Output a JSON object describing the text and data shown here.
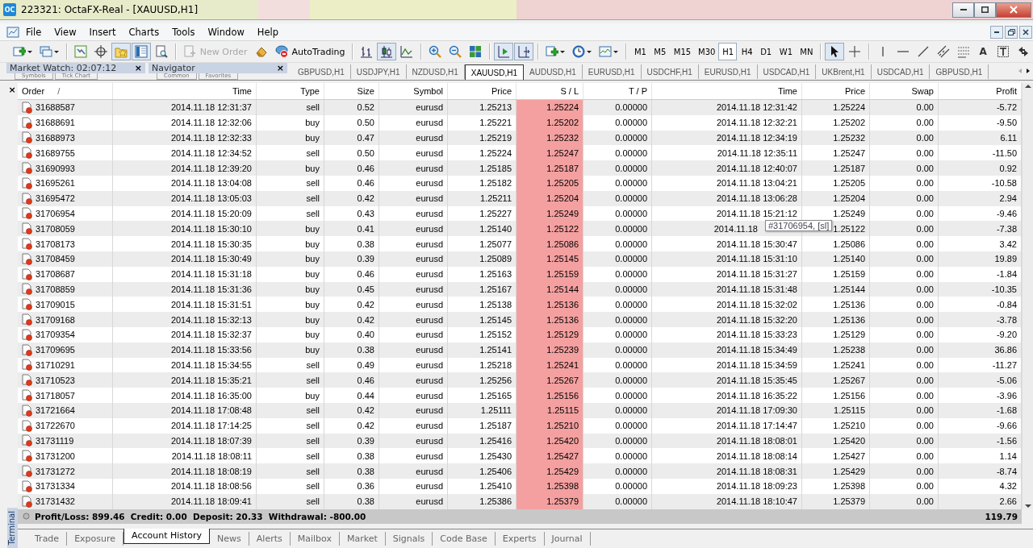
{
  "window": {
    "logo": "OC",
    "title": "223321: OctaFX-Real - [XAUUSD,H1]"
  },
  "menu": [
    "File",
    "View",
    "Insert",
    "Charts",
    "Tools",
    "Window",
    "Help"
  ],
  "toolbar": [
    {
      "kind": "icon",
      "on": false,
      "dropdown": true
    },
    {
      "kind": "icon",
      "on": false,
      "dropdown": true
    },
    {
      "kind": "separator"
    },
    {
      "kind": "icon",
      "on": false
    },
    {
      "kind": "icon",
      "on": false
    },
    {
      "kind": "icon",
      "on": true
    },
    {
      "kind": "icon",
      "on": true
    },
    {
      "kind": "icon",
      "on": false
    },
    {
      "kind": "separator"
    },
    {
      "kind": "button",
      "label": "New Order",
      "disabled": true
    },
    {
      "kind": "icon",
      "on": false
    },
    {
      "kind": "button",
      "label": "AutoTrading",
      "disabled": false
    },
    {
      "kind": "separator"
    },
    {
      "kind": "icon",
      "on": false
    },
    {
      "kind": "icon",
      "on": true
    },
    {
      "kind": "icon",
      "on": false
    },
    {
      "kind": "separator"
    },
    {
      "kind": "icon",
      "on": false
    },
    {
      "kind": "icon",
      "on": false
    },
    {
      "kind": "icon",
      "on": false
    },
    {
      "kind": "separator"
    },
    {
      "kind": "icon",
      "on": true
    },
    {
      "kind": "icon",
      "on": true
    },
    {
      "kind": "separator"
    },
    {
      "kind": "icon",
      "on": false,
      "dropdown": true
    },
    {
      "kind": "icon",
      "on": false,
      "dropdown": true
    },
    {
      "kind": "icon",
      "on": false,
      "dropdown": true
    },
    {
      "kind": "separator"
    },
    {
      "kind": "timeframe",
      "label": "M1",
      "selected": false
    },
    {
      "kind": "timeframe",
      "label": "M5",
      "selected": false
    },
    {
      "kind": "timeframe",
      "label": "M15",
      "selected": false
    },
    {
      "kind": "timeframe",
      "label": "M30",
      "selected": false
    },
    {
      "kind": "timeframe",
      "label": "H1",
      "selected": true
    },
    {
      "kind": "timeframe",
      "label": "H4",
      "selected": false
    },
    {
      "kind": "timeframe",
      "label": "D1",
      "selected": false
    },
    {
      "kind": "timeframe",
      "label": "W1",
      "selected": false
    },
    {
      "kind": "timeframe",
      "label": "MN",
      "selected": false
    },
    {
      "kind": "separator"
    },
    {
      "kind": "icon",
      "on": true
    },
    {
      "kind": "icon",
      "on": false
    },
    {
      "kind": "separator"
    },
    {
      "kind": "icon",
      "on": false
    },
    {
      "kind": "icon",
      "on": false
    },
    {
      "kind": "icon",
      "on": false
    },
    {
      "kind": "icon",
      "on": false
    },
    {
      "kind": "icon",
      "on": false
    },
    {
      "kind": "glyph",
      "label": "A"
    },
    {
      "kind": "icon",
      "on": false
    },
    {
      "kind": "icon",
      "on": false
    }
  ],
  "panels": [
    {
      "title": "Market Watch: 02:07:12",
      "close": "×",
      "tabs": [
        "Symbols",
        "Tick Chart"
      ]
    },
    {
      "title": "Navigator",
      "close": "×",
      "tabs": [
        "Common",
        "Favorites"
      ]
    }
  ],
  "chart_tabs": [
    {
      "label": "GBPUSD,H1",
      "selected": false
    },
    {
      "label": "USDJPY,H1",
      "selected": false
    },
    {
      "label": "NZDUSD,H1",
      "selected": false
    },
    {
      "label": "XAUUSD,H1",
      "selected": true
    },
    {
      "label": "AUDUSD,H1",
      "selected": false
    },
    {
      "label": "EURUSD,H1",
      "selected": false
    },
    {
      "label": "USDCHF,H1",
      "selected": false
    },
    {
      "label": "EURUSD,H1",
      "selected": false
    },
    {
      "label": "USDCAD,H1",
      "selected": false
    },
    {
      "label": "UKBrent,H1",
      "selected": false
    },
    {
      "label": "USDCAD,H1",
      "selected": false
    },
    {
      "label": "GBPUSD,H1",
      "selected": false
    }
  ],
  "terminal": {
    "label": "Terminal",
    "close": "×",
    "columns": [
      {
        "label": "Order",
        "sort": "/",
        "highlighted": false
      },
      {
        "label": "Time",
        "highlighted": false
      },
      {
        "label": "Type",
        "highlighted": false
      },
      {
        "label": "Size",
        "highlighted": false
      },
      {
        "label": "Symbol",
        "highlighted": false
      },
      {
        "label": "Price",
        "highlighted": false
      },
      {
        "label": "S / L",
        "highlighted": true
      },
      {
        "label": "T / P",
        "highlighted": false
      },
      {
        "label": "Time",
        "highlighted": false
      },
      {
        "label": "Price",
        "highlighted": false
      },
      {
        "label": "Swap",
        "highlighted": false
      },
      {
        "label": "Profit",
        "highlighted": false
      }
    ],
    "rows": [
      {
        "cells": [
          "31688587",
          "2014.11.18 12:31:37",
          "sell",
          "0.52",
          "eurusd",
          "1.25213",
          "1.25224",
          "0.00000",
          "2014.11.18 12:31:42",
          "1.25224",
          "0.00",
          "-5.72"
        ]
      },
      {
        "cells": [
          "31688691",
          "2014.11.18 12:32:06",
          "buy",
          "0.50",
          "eurusd",
          "1.25221",
          "1.25202",
          "0.00000",
          "2014.11.18 12:32:21",
          "1.25202",
          "0.00",
          "-9.50"
        ]
      },
      {
        "cells": [
          "31688973",
          "2014.11.18 12:32:33",
          "buy",
          "0.47",
          "eurusd",
          "1.25219",
          "1.25232",
          "0.00000",
          "2014.11.18 12:34:19",
          "1.25232",
          "0.00",
          "6.11"
        ]
      },
      {
        "cells": [
          "31689755",
          "2014.11.18 12:34:52",
          "sell",
          "0.50",
          "eurusd",
          "1.25224",
          "1.25247",
          "0.00000",
          "2014.11.18 12:35:11",
          "1.25247",
          "0.00",
          "-11.50"
        ]
      },
      {
        "cells": [
          "31690993",
          "2014.11.18 12:39:20",
          "buy",
          "0.46",
          "eurusd",
          "1.25185",
          "1.25187",
          "0.00000",
          "2014.11.18 12:40:07",
          "1.25187",
          "0.00",
          "0.92"
        ]
      },
      {
        "cells": [
          "31695261",
          "2014.11.18 13:04:08",
          "sell",
          "0.46",
          "eurusd",
          "1.25182",
          "1.25205",
          "0.00000",
          "2014.11.18 13:04:21",
          "1.25205",
          "0.00",
          "-10.58"
        ]
      },
      {
        "cells": [
          "31695472",
          "2014.11.18 13:05:03",
          "sell",
          "0.42",
          "eurusd",
          "1.25211",
          "1.25204",
          "0.00000",
          "2014.11.18 13:06:28",
          "1.25204",
          "0.00",
          "2.94"
        ]
      },
      {
        "cells": [
          "31706954",
          "2014.11.18 15:20:09",
          "sell",
          "0.43",
          "eurusd",
          "1.25227",
          "1.25249",
          "0.00000",
          "2014.11.18 15:21:12",
          "1.25249",
          "0.00",
          "-9.46"
        ]
      },
      {
        "cells": [
          "31708059",
          "2014.11.18 15:30:10",
          "buy",
          "0.41",
          "eurusd",
          "1.25140",
          "1.25122",
          "0.00000",
          "2014.11.18",
          "1.25122",
          "0.00",
          "-7.38"
        ],
        "tooltip": "#31706954, [sl]"
      },
      {
        "cells": [
          "31708173",
          "2014.11.18 15:30:35",
          "buy",
          "0.38",
          "eurusd",
          "1.25077",
          "1.25086",
          "0.00000",
          "2014.11.18 15:30:47",
          "1.25086",
          "0.00",
          "3.42"
        ]
      },
      {
        "cells": [
          "31708459",
          "2014.11.18 15:30:49",
          "buy",
          "0.39",
          "eurusd",
          "1.25089",
          "1.25145",
          "0.00000",
          "2014.11.18 15:31:10",
          "1.25140",
          "0.00",
          "19.89"
        ]
      },
      {
        "cells": [
          "31708687",
          "2014.11.18 15:31:18",
          "buy",
          "0.46",
          "eurusd",
          "1.25163",
          "1.25159",
          "0.00000",
          "2014.11.18 15:31:27",
          "1.25159",
          "0.00",
          "-1.84"
        ]
      },
      {
        "cells": [
          "31708859",
          "2014.11.18 15:31:36",
          "buy",
          "0.45",
          "eurusd",
          "1.25167",
          "1.25144",
          "0.00000",
          "2014.11.18 15:31:48",
          "1.25144",
          "0.00",
          "-10.35"
        ]
      },
      {
        "cells": [
          "31709015",
          "2014.11.18 15:31:51",
          "buy",
          "0.42",
          "eurusd",
          "1.25138",
          "1.25136",
          "0.00000",
          "2014.11.18 15:32:02",
          "1.25136",
          "0.00",
          "-0.84"
        ]
      },
      {
        "cells": [
          "31709168",
          "2014.11.18 15:32:13",
          "buy",
          "0.42",
          "eurusd",
          "1.25145",
          "1.25136",
          "0.00000",
          "2014.11.18 15:32:20",
          "1.25136",
          "0.00",
          "-3.78"
        ]
      },
      {
        "cells": [
          "31709354",
          "2014.11.18 15:32:37",
          "buy",
          "0.40",
          "eurusd",
          "1.25152",
          "1.25129",
          "0.00000",
          "2014.11.18 15:33:23",
          "1.25129",
          "0.00",
          "-9.20"
        ]
      },
      {
        "cells": [
          "31709695",
          "2014.11.18 15:33:56",
          "buy",
          "0.38",
          "eurusd",
          "1.25141",
          "1.25239",
          "0.00000",
          "2014.11.18 15:34:49",
          "1.25238",
          "0.00",
          "36.86"
        ]
      },
      {
        "cells": [
          "31710291",
          "2014.11.18 15:34:55",
          "sell",
          "0.49",
          "eurusd",
          "1.25218",
          "1.25241",
          "0.00000",
          "2014.11.18 15:34:59",
          "1.25241",
          "0.00",
          "-11.27"
        ]
      },
      {
        "cells": [
          "31710523",
          "2014.11.18 15:35:21",
          "sell",
          "0.46",
          "eurusd",
          "1.25256",
          "1.25267",
          "0.00000",
          "2014.11.18 15:35:45",
          "1.25267",
          "0.00",
          "-5.06"
        ]
      },
      {
        "cells": [
          "31718057",
          "2014.11.18 16:35:00",
          "buy",
          "0.44",
          "eurusd",
          "1.25165",
          "1.25156",
          "0.00000",
          "2014.11.18 16:35:22",
          "1.25156",
          "0.00",
          "-3.96"
        ]
      },
      {
        "cells": [
          "31721664",
          "2014.11.18 17:08:48",
          "sell",
          "0.42",
          "eurusd",
          "1.25111",
          "1.25115",
          "0.00000",
          "2014.11.18 17:09:30",
          "1.25115",
          "0.00",
          "-1.68"
        ]
      },
      {
        "cells": [
          "31722670",
          "2014.11.18 17:14:25",
          "sell",
          "0.42",
          "eurusd",
          "1.25187",
          "1.25210",
          "0.00000",
          "2014.11.18 17:14:47",
          "1.25210",
          "0.00",
          "-9.66"
        ]
      },
      {
        "cells": [
          "31731119",
          "2014.11.18 18:07:39",
          "sell",
          "0.39",
          "eurusd",
          "1.25416",
          "1.25420",
          "0.00000",
          "2014.11.18 18:08:01",
          "1.25420",
          "0.00",
          "-1.56"
        ]
      },
      {
        "cells": [
          "31731200",
          "2014.11.18 18:08:11",
          "sell",
          "0.38",
          "eurusd",
          "1.25430",
          "1.25427",
          "0.00000",
          "2014.11.18 18:08:14",
          "1.25427",
          "0.00",
          "1.14"
        ]
      },
      {
        "cells": [
          "31731272",
          "2014.11.18 18:08:19",
          "sell",
          "0.38",
          "eurusd",
          "1.25406",
          "1.25429",
          "0.00000",
          "2014.11.18 18:08:31",
          "1.25429",
          "0.00",
          "-8.74"
        ]
      },
      {
        "cells": [
          "31731334",
          "2014.11.18 18:08:56",
          "sell",
          "0.36",
          "eurusd",
          "1.25410",
          "1.25398",
          "0.00000",
          "2014.11.18 18:09:23",
          "1.25398",
          "0.00",
          "4.32"
        ]
      },
      {
        "cells": [
          "31731432",
          "2014.11.18 18:09:41",
          "sell",
          "0.38",
          "eurusd",
          "1.25386",
          "1.25379",
          "0.00000",
          "2014.11.18 18:10:47",
          "1.25379",
          "0.00",
          "2.66"
        ]
      }
    ],
    "summary": "Profit/Loss: 899.46  Credit: 0.00  Deposit: 20.33  Withdrawal: -800.00",
    "total": "119.79",
    "tabs": [
      {
        "label": "Trade",
        "selected": false
      },
      {
        "label": "Exposure",
        "selected": false
      },
      {
        "label": "Account History",
        "selected": true
      },
      {
        "label": "News",
        "selected": false
      },
      {
        "label": "Alerts",
        "selected": false
      },
      {
        "label": "Mailbox",
        "selected": false
      },
      {
        "label": "Market",
        "selected": false
      },
      {
        "label": "Signals",
        "selected": false
      },
      {
        "label": "Code Base",
        "selected": false
      },
      {
        "label": "Experts",
        "selected": false
      },
      {
        "label": "Journal",
        "selected": false
      }
    ]
  }
}
